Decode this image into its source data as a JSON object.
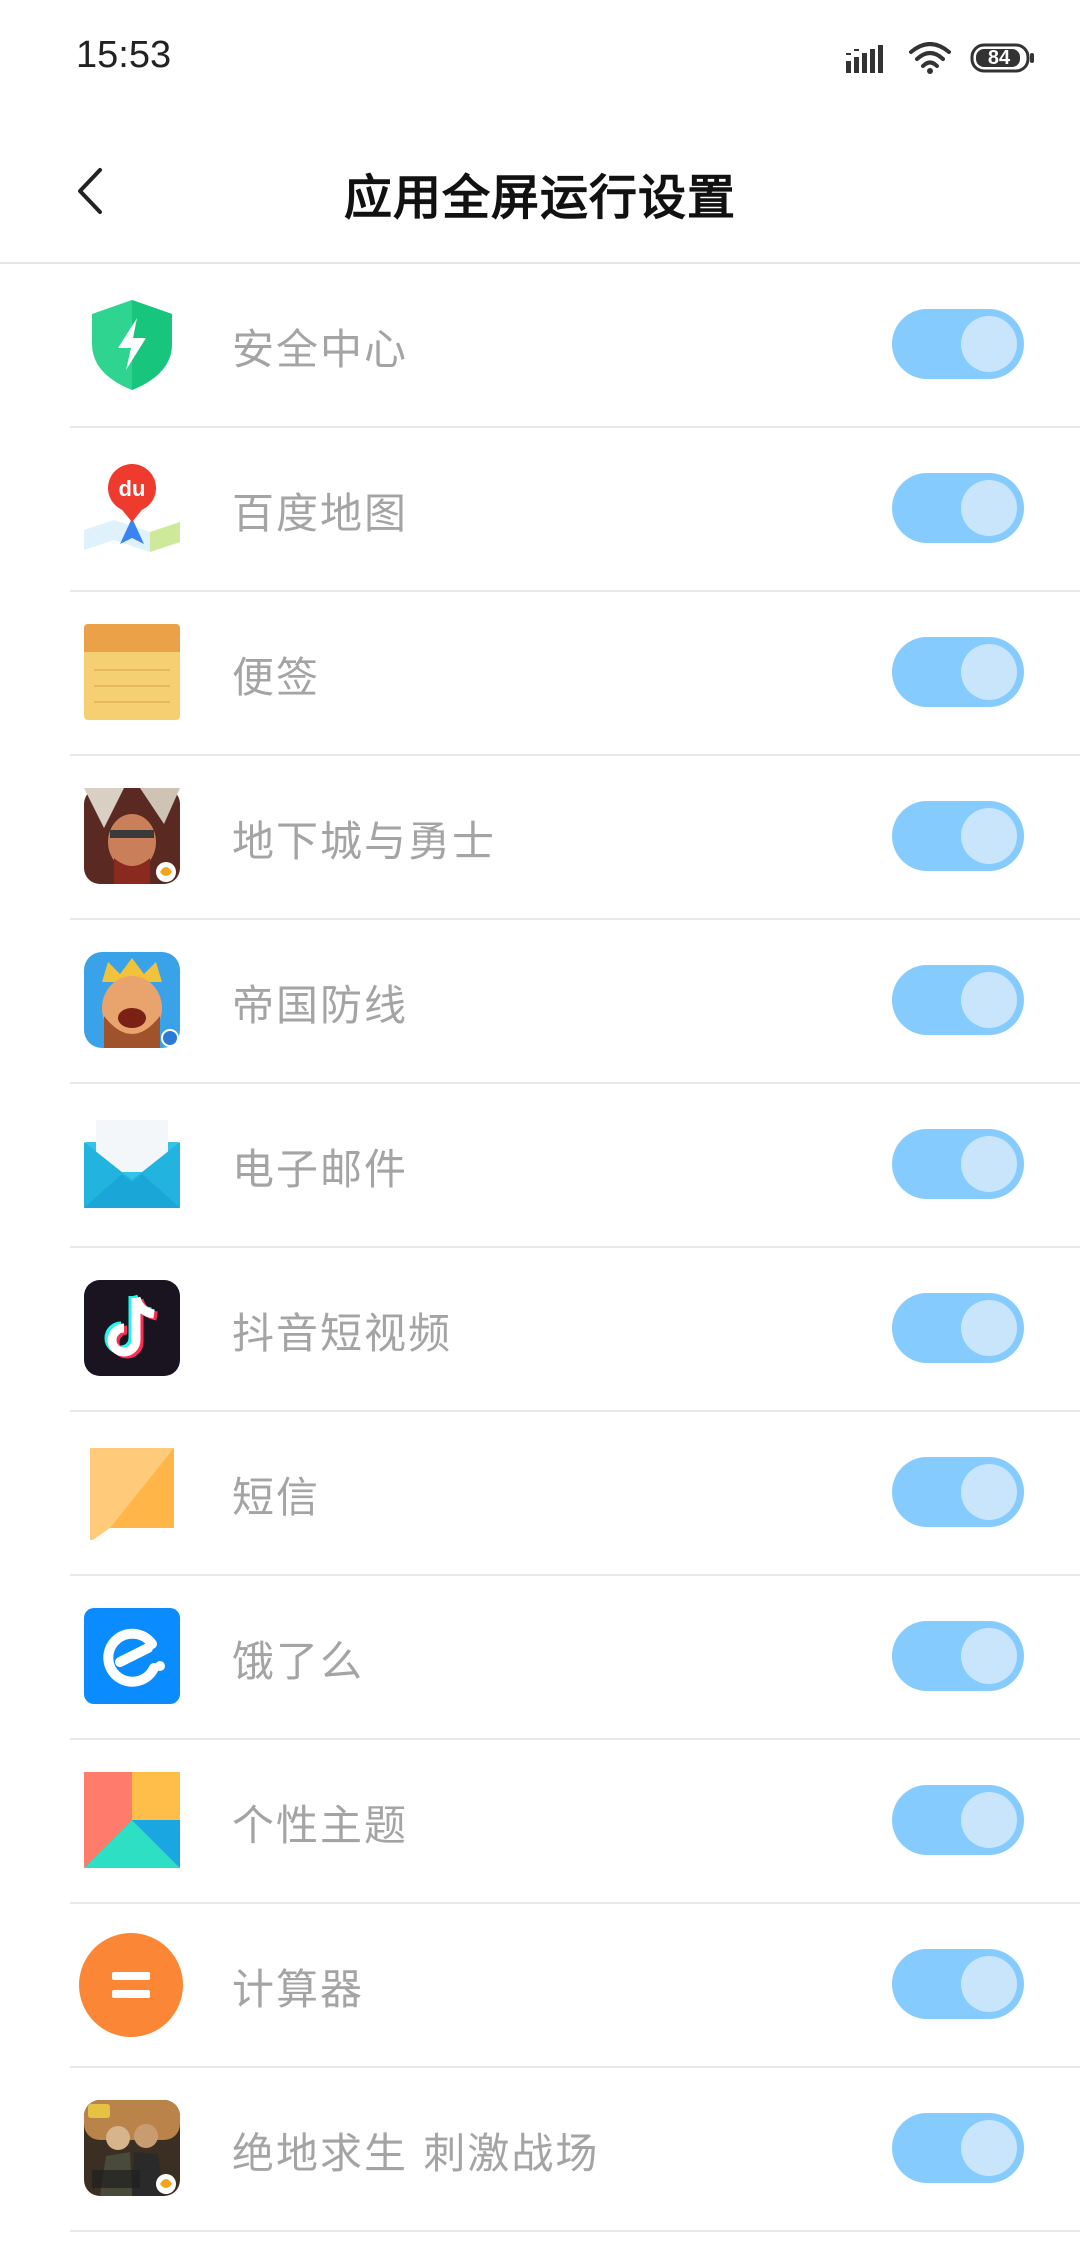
{
  "status_bar": {
    "time": "15:53",
    "battery": "84"
  },
  "header": {
    "title": "应用全屏运行设置"
  },
  "apps": [
    {
      "label": "安全中心",
      "icon": "security-center-icon",
      "enabled": true
    },
    {
      "label": "百度地图",
      "icon": "baidu-map-icon",
      "enabled": true
    },
    {
      "label": "便签",
      "icon": "notes-icon",
      "enabled": true
    },
    {
      "label": "地下城与勇士",
      "icon": "dnf-game-icon",
      "enabled": true
    },
    {
      "label": "帝国防线",
      "icon": "empire-defense-game-icon",
      "enabled": true
    },
    {
      "label": "电子邮件",
      "icon": "email-icon",
      "enabled": true
    },
    {
      "label": "抖音短视频",
      "icon": "douyin-icon",
      "enabled": true
    },
    {
      "label": "短信",
      "icon": "sms-icon",
      "enabled": true
    },
    {
      "label": "饿了么",
      "icon": "eleme-icon",
      "enabled": true
    },
    {
      "label": "个性主题",
      "icon": "themes-icon",
      "enabled": true
    },
    {
      "label": "计算器",
      "icon": "calculator-icon",
      "enabled": true
    },
    {
      "label": "绝地求生 刺激战场",
      "icon": "pubg-game-icon",
      "enabled": true
    }
  ],
  "colors": {
    "toggle_on": "#86cbfd",
    "toggle_knob": "#c8e5fc",
    "label_text": "#a4a4a4"
  }
}
